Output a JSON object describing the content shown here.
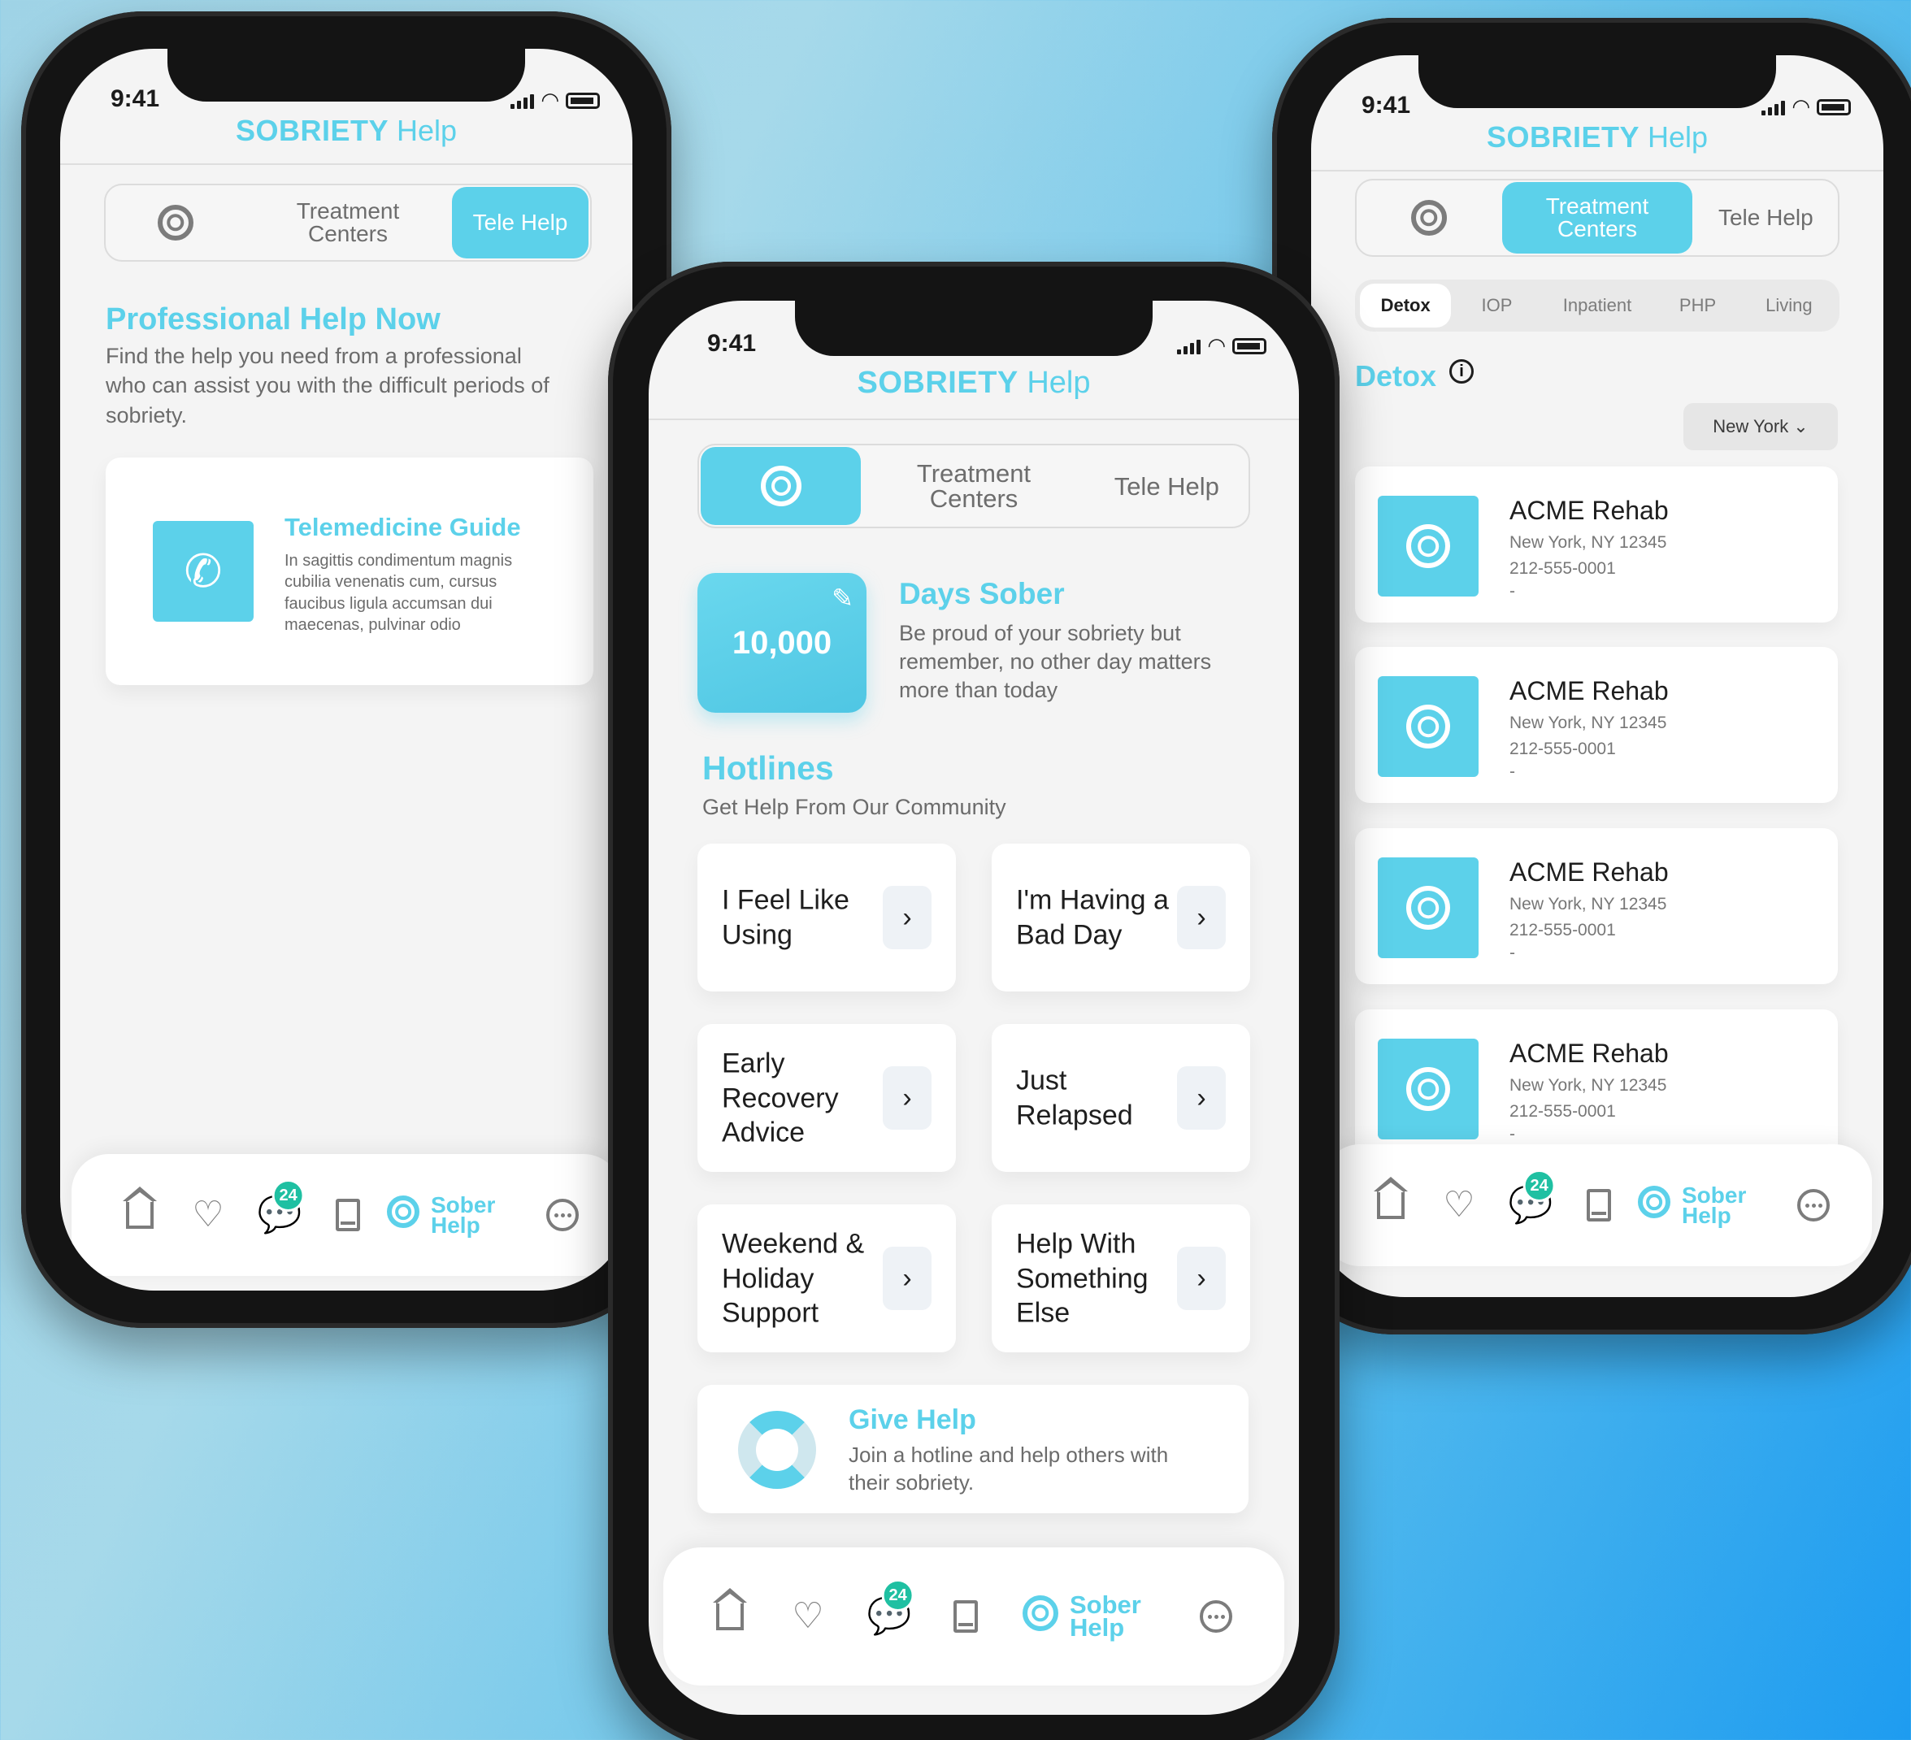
{
  "status": {
    "time": "9:41"
  },
  "brand": {
    "bold": "SOBRIETY",
    "light": "Help"
  },
  "segments": {
    "treatment": "Treatment Centers",
    "tele": "Tele Help"
  },
  "left": {
    "title": "Professional Help Now",
    "body": "Find the help you need from a professional who can assist you with the difficult periods of sobriety.",
    "guide_title": "Telemedicine Guide",
    "guide_body": "In sagittis condimentum magnis cubilia venenatis cum, cursus faucibus ligula accumsan dui maecenas, pulvinar odio"
  },
  "center": {
    "days_value": "10,000",
    "days_title": "Days Sober",
    "days_body": "Be proud of your sobriety but remember, no other day matters more than today",
    "hotlines_title": "Hotlines",
    "hotlines_sub": "Get Help From Our Community",
    "hotlines": [
      {
        "label": "I Feel Like Using"
      },
      {
        "label": "I'm Having a Bad Day"
      },
      {
        "label": "Early Recovery Advice"
      },
      {
        "label": "Just Relapsed"
      },
      {
        "label": "Weekend & Holiday Support"
      },
      {
        "label": "Help With Something Else"
      }
    ],
    "give_title": "Give Help",
    "give_body": "Join a hotline and help others with their sobriety."
  },
  "right": {
    "filters": [
      "Detox",
      "IOP",
      "Inpatient",
      "PHP",
      "Living"
    ],
    "section_title": "Detox",
    "location": "New York",
    "rehabs": [
      {
        "name": "ACME Rehab",
        "address": "New York, NY 12345",
        "phone": "212-555-0001",
        "extra": "-"
      },
      {
        "name": "ACME Rehab",
        "address": "New York, NY 12345",
        "phone": "212-555-0001",
        "extra": "-"
      },
      {
        "name": "ACME Rehab",
        "address": "New York, NY 12345",
        "phone": "212-555-0001",
        "extra": "-"
      },
      {
        "name": "ACME Rehab",
        "address": "New York, NY 12345",
        "phone": "212-555-0001",
        "extra": "-"
      }
    ]
  },
  "tabbar": {
    "badge": "24",
    "active_line1": "Sober",
    "active_line2": "Help"
  },
  "colors": {
    "accent": "#5cd1ea",
    "badge": "#1fc0a2"
  }
}
